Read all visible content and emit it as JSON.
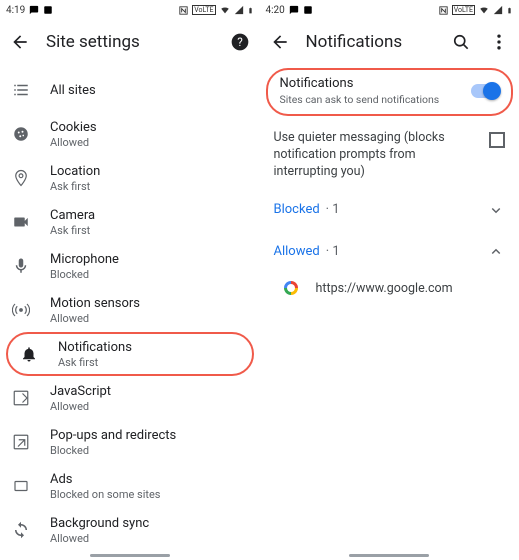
{
  "left": {
    "status": {
      "time": "4:19"
    },
    "title": "Site settings",
    "items": [
      {
        "label": "All sites",
        "sub": ""
      },
      {
        "label": "Cookies",
        "sub": "Allowed"
      },
      {
        "label": "Location",
        "sub": "Ask first"
      },
      {
        "label": "Camera",
        "sub": "Ask first"
      },
      {
        "label": "Microphone",
        "sub": "Blocked"
      },
      {
        "label": "Motion sensors",
        "sub": "Allowed"
      },
      {
        "label": "Notifications",
        "sub": "Ask first"
      },
      {
        "label": "JavaScript",
        "sub": "Allowed"
      },
      {
        "label": "Pop-ups and redirects",
        "sub": "Blocked"
      },
      {
        "label": "Ads",
        "sub": "Blocked on some sites"
      },
      {
        "label": "Background sync",
        "sub": "Allowed"
      }
    ]
  },
  "right": {
    "status": {
      "time": "4:20"
    },
    "title": "Notifications",
    "toggle": {
      "label": "Notifications",
      "sub": "Sites can ask to send notifications"
    },
    "quiet": "Use quieter messaging (blocks notification prompts from interrupting you)",
    "blocked": {
      "label": "Blocked",
      "count": "· 1"
    },
    "allowed": {
      "label": "Allowed",
      "count": "· 1"
    },
    "site": "https://www.google.com"
  }
}
